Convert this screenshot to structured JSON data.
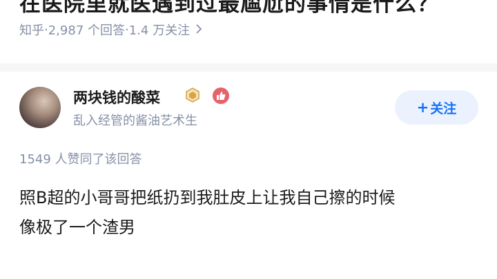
{
  "question": {
    "title": "在医院里就医遇到过最尴尬的事情是什么？",
    "source": "知乎",
    "answer_count": "2,987 个回答",
    "follow_count": "1.4 万关注",
    "separator": " · "
  },
  "author": {
    "name": "两块钱的酸菜",
    "bio": "乱入经管的酱油艺术生"
  },
  "follow_button": {
    "plus": "+",
    "label": "关注"
  },
  "answer": {
    "likes": "1549 人赞同了该回答",
    "line1": "照B超的小哥哥把纸扔到我肚皮上让我自己擦的时候",
    "line2": "像极了一个渣男"
  },
  "colors": {
    "accent": "#1772f6",
    "follow_bg": "#ebf2fd",
    "muted": "#8590a6",
    "badge_gold": "#d9a441",
    "badge_red": "#e5636a"
  },
  "icons": [
    "chevron-right-icon",
    "gold-badge-icon",
    "like-badge-icon"
  ]
}
